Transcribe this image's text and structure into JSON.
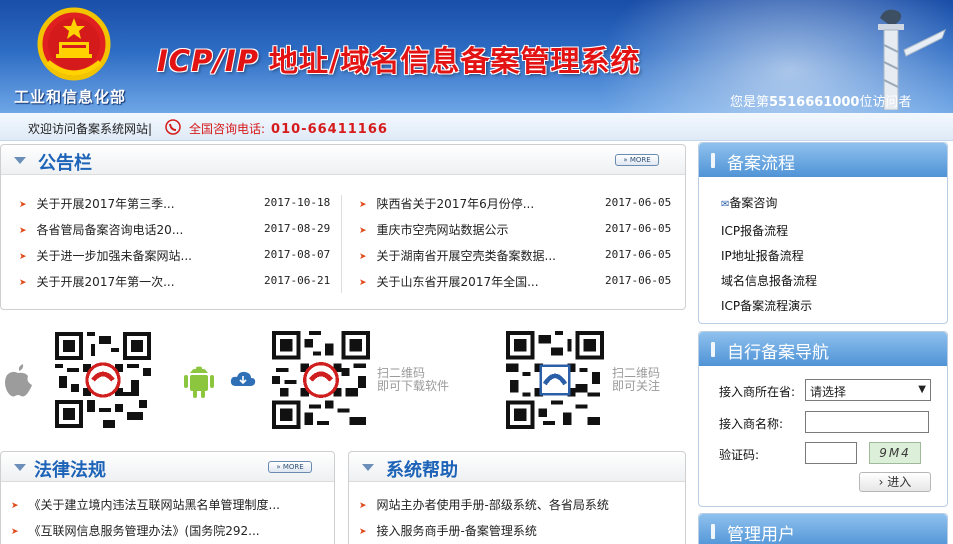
{
  "header": {
    "ministry": "工业和信息化部",
    "title_en": "ICP/IP",
    "title_cn": "地址/域名信息备案管理系统",
    "visitor_prefix": "您是第",
    "visitor_count": "5516661000",
    "visitor_suffix": "位访问者"
  },
  "welcome": {
    "text": "欢迎访问备案系统网站|",
    "hotline_label": "全国咨询电话:",
    "hotline_number": "010-66411166"
  },
  "announcements": {
    "title": "公告栏",
    "more": "MORE",
    "left": [
      {
        "title": "关于开展2017年第三季...",
        "date": "2017-10-18"
      },
      {
        "title": "各省管局备案咨询电话20...",
        "date": "2017-08-29"
      },
      {
        "title": "关于进一步加强未备案网站...",
        "date": "2017-08-07"
      },
      {
        "title": "关于开展2017年第一次...",
        "date": "2017-06-21"
      }
    ],
    "right": [
      {
        "title": "陕西省关于2017年6月份停...",
        "date": "2017-06-05"
      },
      {
        "title": "重庆市空壳网站数据公示",
        "date": "2017-06-05"
      },
      {
        "title": "关于湖南省开展空壳类备案数据...",
        "date": "2017-06-05"
      },
      {
        "title": "关于山东省开展2017年全国...",
        "date": "2017-06-05"
      }
    ]
  },
  "qr": {
    "download_caption_1": "扫二维码",
    "download_caption_2": "即可下载软件",
    "follow_caption_1": "扫二维码",
    "follow_caption_2": "即可关注"
  },
  "laws": {
    "title": "法律法规",
    "more": "MORE",
    "items": [
      "《关于建立境内违法互联网站黑名单管理制度...",
      "《互联网信息服务管理办法》(国务院292..."
    ]
  },
  "help": {
    "title": "系统帮助",
    "items": [
      "网站主办者使用手册-部级系统、各省局系统",
      "接入服务商手册-备案管理系统"
    ]
  },
  "process": {
    "title": "备案流程",
    "items": [
      "备案咨询",
      "ICP报备流程",
      "IP地址报备流程",
      "域名信息报备流程",
      "ICP备案流程演示"
    ]
  },
  "self_nav": {
    "title": "自行备案导航",
    "province_label": "接入商所在省:",
    "province_value": "请选择",
    "name_label": "接入商名称:",
    "captcha_label": "验证码:",
    "captcha_text": "9M4",
    "enter": "进入"
  },
  "manage": {
    "title": "管理用户"
  },
  "colors": {
    "header_blue": "#2d6cc4",
    "title_red": "#e31313",
    "panel_title_blue": "#1d63b7",
    "bullet_orange": "#e04a1a"
  }
}
